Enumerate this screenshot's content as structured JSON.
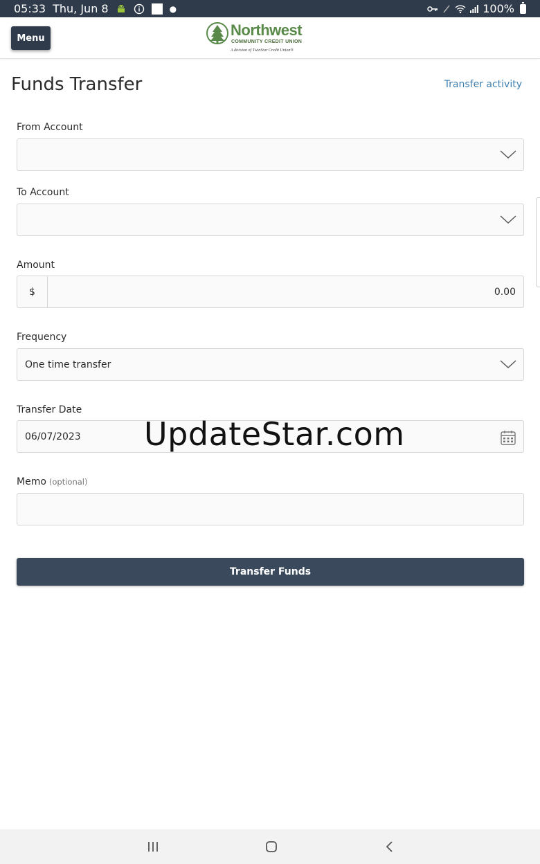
{
  "status_bar": {
    "time": "05:33",
    "date": "Thu, Jun 8",
    "battery": "100%"
  },
  "header": {
    "menu_label": "Menu",
    "logo": {
      "name": "Northwest",
      "subtitle": "COMMUNITY CREDIT UNION",
      "tagline": "A division of TwinStar Credit Union®"
    }
  },
  "page": {
    "title": "Funds Transfer",
    "activity_link": "Transfer activity"
  },
  "form": {
    "from_account": {
      "label": "From Account",
      "value": ""
    },
    "to_account": {
      "label": "To Account",
      "value": ""
    },
    "amount": {
      "label": "Amount",
      "prefix": "$",
      "value": "0.00"
    },
    "frequency": {
      "label": "Frequency",
      "value": "One time transfer"
    },
    "transfer_date": {
      "label": "Transfer Date",
      "value": "06/07/2023"
    },
    "memo": {
      "label": "Memo",
      "optional": "(optional)",
      "value": ""
    },
    "submit_label": "Transfer Funds"
  },
  "watermark": "UpdateStar.com",
  "icons": {
    "android": "android-icon",
    "info": "info-icon",
    "key": "key-icon",
    "wifi": "wifi-icon",
    "signal": "signal-icon",
    "battery": "battery-icon",
    "chevron": "chevron-down-icon",
    "calendar": "calendar-icon",
    "recents": "recents-icon",
    "home": "home-icon",
    "back": "back-icon"
  },
  "colors": {
    "status_bar_bg": "#2f3b4a",
    "primary_button": "#3a4a5c",
    "link": "#3e7fb0",
    "brand_green": "#5a8a4a"
  }
}
